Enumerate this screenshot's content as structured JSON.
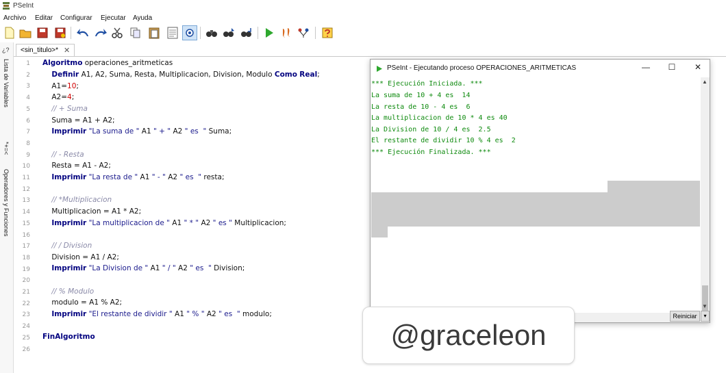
{
  "window": {
    "title": "PSeInt"
  },
  "menu": [
    "Archivo",
    "Editar",
    "Configurar",
    "Ejecutar",
    "Ayuda"
  ],
  "toolbar": {
    "icons": [
      "new-file-icon",
      "open-folder-icon",
      "save-icon",
      "save-as-icon",
      "undo-icon",
      "redo-icon",
      "cut-icon",
      "copy-icon",
      "paste-icon",
      "select-all-icon",
      "find-icon",
      "binoculars-icon",
      "find-next-icon",
      "replace-icon",
      "run-icon",
      "step-icon",
      "flowchart-icon",
      "help-icon"
    ]
  },
  "side_panel": {
    "variables_label": "Lista de Variables",
    "operators_label": "Operadores y Funciones",
    "variables_icon_text": "*+=<",
    "top_icon_text": "¿?"
  },
  "editor": {
    "tab_label": "<sin_titulo>*",
    "tab_close": "✕",
    "line_numbers": [
      "1",
      "2",
      "3",
      "4",
      "5",
      "6",
      "7",
      "8",
      "9",
      "10",
      "11",
      "12",
      "13",
      "14",
      "15",
      "16",
      "17",
      "18",
      "19",
      "20",
      "21",
      "22",
      "23",
      "24",
      "25",
      "26"
    ]
  },
  "console": {
    "title": "PSeInt - Ejecutando proceso OPERACIONES_ARITMETICAS",
    "minimize": "—",
    "maximize": "☐",
    "close": "✕",
    "output": [
      "*** Ejecución Iniciada. ***",
      "La suma de 10 + 4 es  14",
      "La resta de 10 - 4 es  6",
      "La multiplicacion de 10 * 4 es 40",
      "La Division de 10 / 4 es  2.5",
      "El restante de dividir 10 % 4 es  2",
      "*** Ejecución Finalizada. ***"
    ],
    "restart_label": "Reiniciar",
    "output_color": "#0e8a0e"
  },
  "watermark": {
    "text": "@graceleon"
  },
  "colors": {
    "keyword": "#00007f",
    "number": "#d00000",
    "comment": "#8a8aa8",
    "console_text": "#0e8a0e"
  }
}
